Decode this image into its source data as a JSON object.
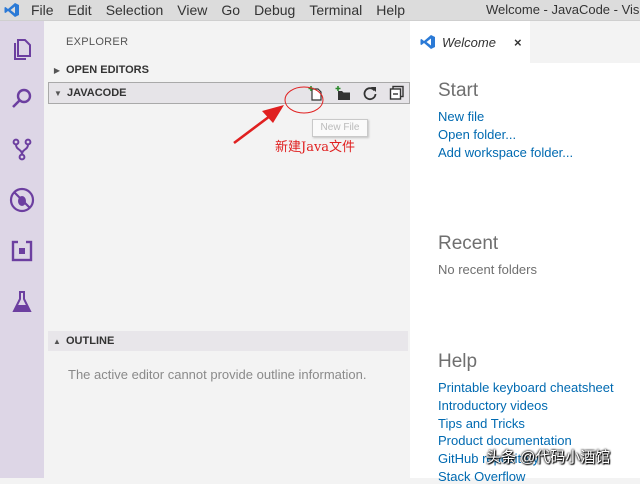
{
  "menu": [
    "File",
    "Edit",
    "Selection",
    "View",
    "Go",
    "Debug",
    "Terminal",
    "Help"
  ],
  "window_title": "Welcome - JavaCode - Visua",
  "activity_icons": [
    "explorer-icon",
    "search-icon",
    "source-control-icon",
    "debug-icon",
    "extensions-icon",
    "test-icon"
  ],
  "colors": {
    "accent": "#6c3fa0",
    "link": "#006ab1",
    "annotation": "#e02020",
    "activity_bar": "#ddd6e6"
  },
  "sidebar": {
    "title": "EXPLORER",
    "open_editors": "OPEN EDITORS",
    "workspace": "JAVACODE",
    "outline": "OUTLINE",
    "outline_message": "The active editor cannot provide outline information.",
    "tooltip": "New File",
    "annotation": "新建Java文件"
  },
  "tab": {
    "label": "Welcome",
    "close": "×"
  },
  "welcome": {
    "start_heading": "Start",
    "new_file": "New file",
    "open_folder": "Open folder...",
    "add_workspace_folder": "Add workspace folder...",
    "recent_heading": "Recent",
    "no_recent": "No recent folders",
    "help_heading": "Help",
    "help_links": [
      "Printable keyboard cheatsheet",
      "Introductory videos",
      "Tips and Tricks",
      "Product documentation",
      "GitHub repository",
      "Stack Overflow"
    ]
  },
  "watermark": "头条 @代码小酒馆"
}
